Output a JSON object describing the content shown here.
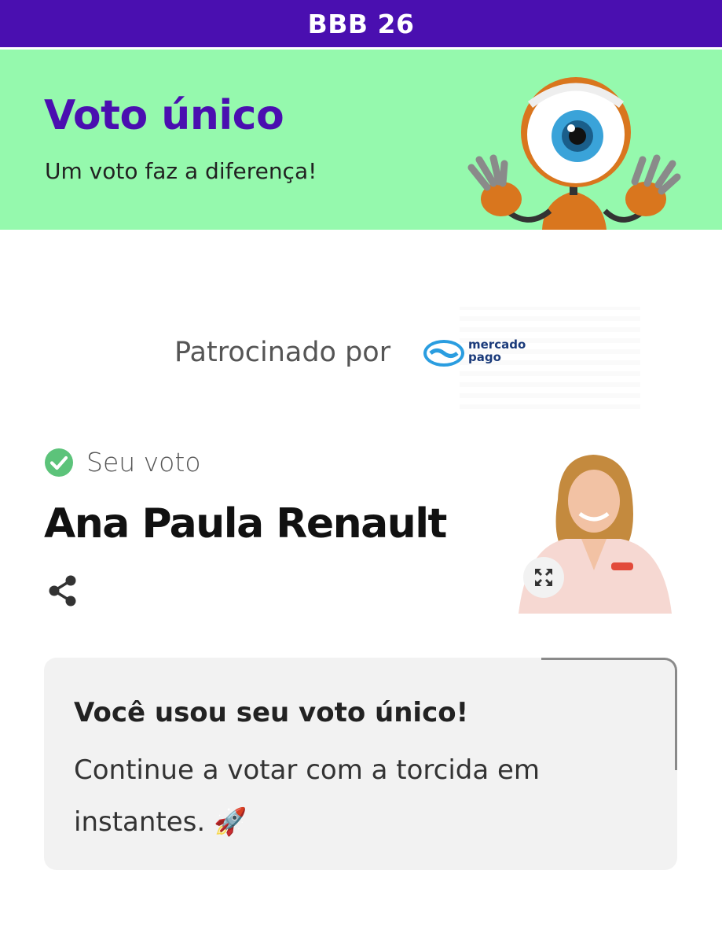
{
  "header": {
    "title": "BBB 26"
  },
  "banner": {
    "title": "Voto único",
    "subtitle": "Um voto faz a diferença!",
    "background_color": "#95f9ad",
    "title_color": "#4a0fb0",
    "mascot_icon": "big-brother-eye-robot-mascot"
  },
  "sponsor": {
    "label": "Patrocinado por",
    "logo_text_line1": "mercado",
    "logo_text_line2": "pago",
    "logo_icon": "handshake-logo"
  },
  "vote": {
    "status_label": "Seu voto",
    "status_icon": "check-circle-icon",
    "candidate_name": "Ana Paula Renault",
    "share_icon": "share-icon",
    "expand_icon": "expand-icon"
  },
  "notice": {
    "title": "Você usou seu voto único!",
    "body": "Continue a votar com a torcida em instantes. 🚀"
  },
  "colors": {
    "topbar": "#4a0fb0",
    "check": "#5cc37a",
    "card_bg": "#f2f2f2"
  }
}
